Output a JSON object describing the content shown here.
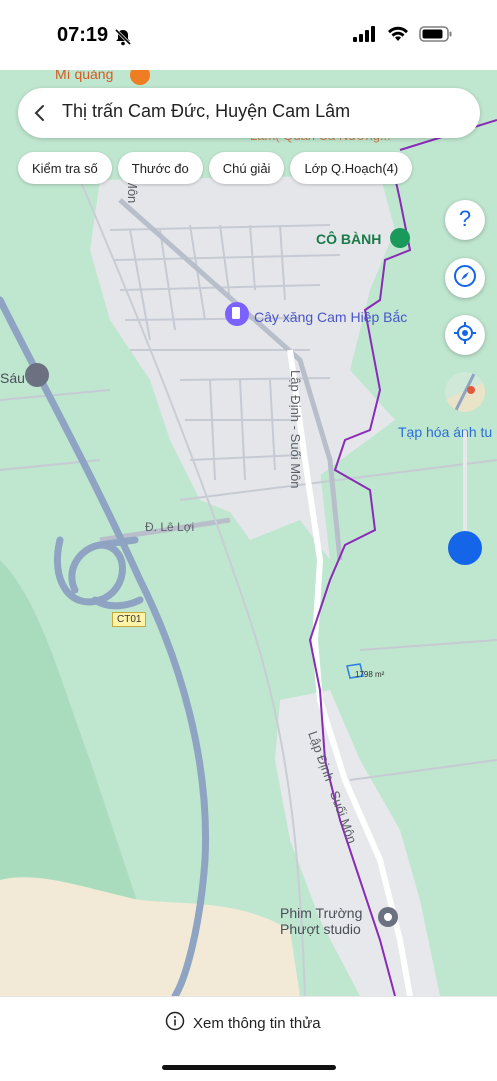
{
  "status_bar": {
    "time": "07:19"
  },
  "search": {
    "title": "Thị trấn Cam Đức, Huyện Cam Lâm"
  },
  "toolbar": {
    "chips": [
      "Kiểm tra số",
      "Thước đo",
      "Chú giải",
      "Lớp Q.Hoạch(4)"
    ]
  },
  "map": {
    "poi_top": "Mì quảng",
    "poi_top_partial": "Lâm( Quán Ca Nương...",
    "poi_co_banh": "CÔ BÀNH",
    "poi_gas": "Cây xăng Cam Hiệp Bắc",
    "poi_sau": "Sáu",
    "poi_grocery": "Tạp hóa ánh tu",
    "road_le_loi": "Đ. Lê Lợi",
    "road_ct01": "CT01",
    "road_lap_dinh_1": "Lập Định - Suối Môn",
    "road_lap_dinh_2": "Lập Định - Suối Môn",
    "road_mon": "Môn",
    "parcel_area": "1798 m²",
    "poi_studio_1": "Phim Trường",
    "poi_studio_2": "Phượt studio"
  },
  "bottom": {
    "info_label": "Xem thông tin thửa"
  },
  "icons": [
    "bell-slash-icon",
    "signal-icon",
    "wifi-icon",
    "battery-icon",
    "back-icon",
    "help-icon",
    "compass-icon",
    "locate-icon",
    "layers-icon",
    "info-icon"
  ],
  "colors": {
    "accent": "#1565e8",
    "boundary": "#8a2bb8",
    "map_green": "#bfe6cf",
    "urban": "#e4e6ea"
  }
}
